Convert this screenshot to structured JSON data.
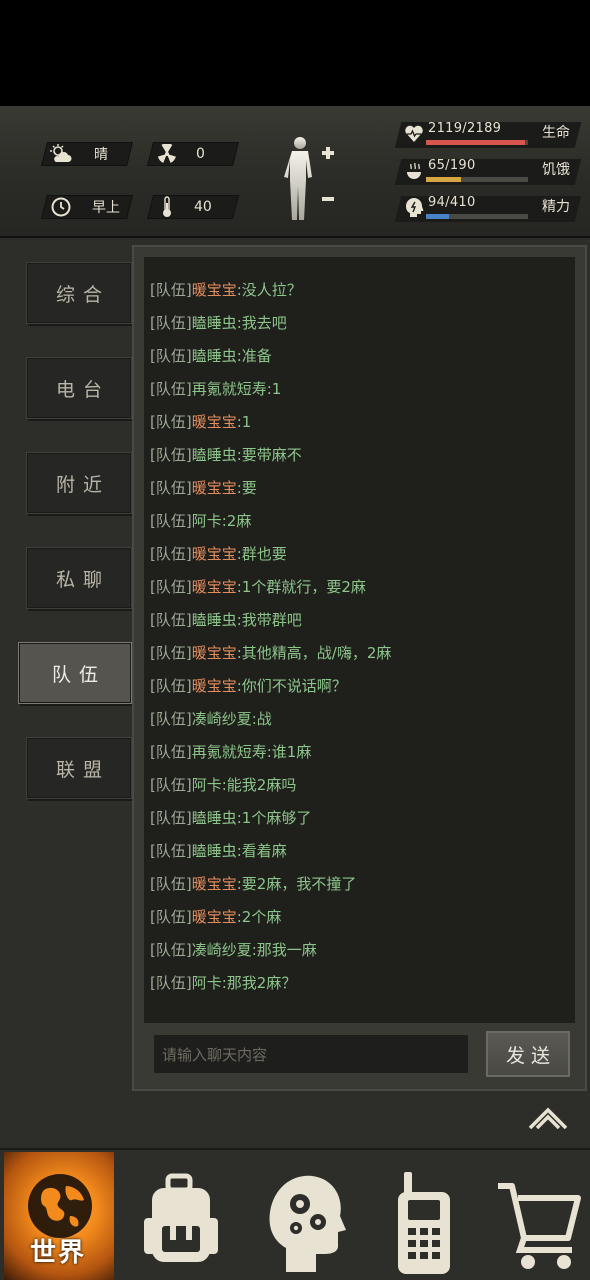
{
  "status": {
    "weather": {
      "icon": "cloud-sun-icon",
      "label": "晴"
    },
    "radiation": {
      "icon": "radiation-icon",
      "value": "0"
    },
    "time": {
      "icon": "clock-icon",
      "label": "早上"
    },
    "temperature": {
      "icon": "thermometer-icon",
      "value": "40"
    },
    "stats": [
      {
        "icon": "heart-icon",
        "value": "2119/2189",
        "label": "生命",
        "fill": 0.968,
        "color": "#d8554e"
      },
      {
        "icon": "food-icon",
        "value": "65/190",
        "label": "饥饿",
        "fill": 0.342,
        "color": "#d6a640"
      },
      {
        "icon": "head-icon",
        "value": "94/410",
        "label": "精力",
        "fill": 0.229,
        "color": "#4a82c8"
      }
    ]
  },
  "sidebar": {
    "tabs": [
      {
        "label": "综合"
      },
      {
        "label": "电台"
      },
      {
        "label": "附近"
      },
      {
        "label": "私聊"
      },
      {
        "label": "队伍",
        "active": true
      },
      {
        "label": "联盟"
      }
    ]
  },
  "chat": {
    "messages": [
      {
        "tag": "[队伍]",
        "name": "暖宝宝",
        "orange": true,
        "text": ":没人拉？"
      },
      {
        "tag": "[队伍]",
        "name": "瞌睡虫",
        "orange": false,
        "text": ":我去吧"
      },
      {
        "tag": "[队伍]",
        "name": "瞌睡虫",
        "orange": false,
        "text": ":准备"
      },
      {
        "tag": "[队伍]",
        "name": "再氪就短寿",
        "orange": false,
        "text": ":1"
      },
      {
        "tag": "[队伍]",
        "name": "暖宝宝",
        "orange": true,
        "text": ":1"
      },
      {
        "tag": "[队伍]",
        "name": "瞌睡虫",
        "orange": false,
        "text": ":要带麻不"
      },
      {
        "tag": "[队伍]",
        "name": "暖宝宝",
        "orange": true,
        "text": ":要"
      },
      {
        "tag": "[队伍]",
        "name": "阿卡",
        "orange": false,
        "text": ":2麻"
      },
      {
        "tag": "[队伍]",
        "name": "暖宝宝",
        "orange": true,
        "text": ":群也要"
      },
      {
        "tag": "[队伍]",
        "name": "暖宝宝",
        "orange": true,
        "text": ":1个群就行，要2麻"
      },
      {
        "tag": "[队伍]",
        "name": "瞌睡虫",
        "orange": false,
        "text": ":我带群吧"
      },
      {
        "tag": "[队伍]",
        "name": "暖宝宝",
        "orange": true,
        "text": ":其他精高，战/嗨，2麻"
      },
      {
        "tag": "[队伍]",
        "name": "暖宝宝",
        "orange": true,
        "text": ":你们不说话啊？"
      },
      {
        "tag": "[队伍]",
        "name": "凑崎纱夏",
        "orange": false,
        "text": ":战"
      },
      {
        "tag": "[队伍]",
        "name": "再氪就短寿",
        "orange": false,
        "text": ":谁1麻"
      },
      {
        "tag": "[队伍]",
        "name": "阿卡",
        "orange": false,
        "text": ":能我2麻吗"
      },
      {
        "tag": "[队伍]",
        "name": "瞌睡虫",
        "orange": false,
        "text": ":1个麻够了"
      },
      {
        "tag": "[队伍]",
        "name": "瞌睡虫",
        "orange": false,
        "text": ":看着麻"
      },
      {
        "tag": "[队伍]",
        "name": "暖宝宝",
        "orange": true,
        "text": ":要2麻，我不撞了"
      },
      {
        "tag": "[队伍]",
        "name": "暖宝宝",
        "orange": true,
        "text": ":2个麻"
      },
      {
        "tag": "[队伍]",
        "name": "凑崎纱夏",
        "orange": false,
        "text": ":那我一麻"
      },
      {
        "tag": "[队伍]",
        "name": "阿卡",
        "orange": false,
        "text": ":那我2麻？"
      }
    ],
    "input_placeholder": "请输入聊天内容",
    "send_label": "发送"
  },
  "bottom_nav": {
    "items": [
      {
        "icon": "globe-icon",
        "label": "世界",
        "active": true
      },
      {
        "icon": "backpack-icon"
      },
      {
        "icon": "brain-gear-icon"
      },
      {
        "icon": "walkie-talkie-icon"
      },
      {
        "icon": "cart-icon"
      }
    ]
  }
}
